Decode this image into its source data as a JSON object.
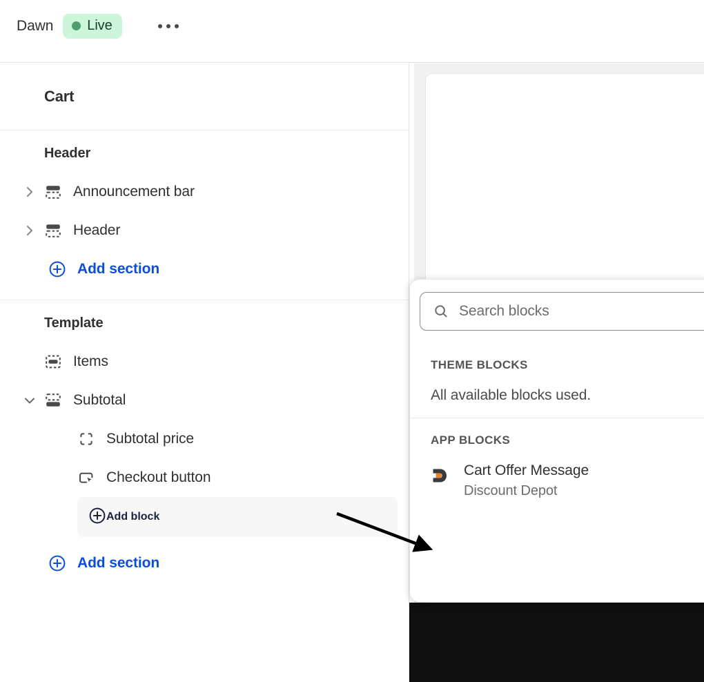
{
  "topbar": {
    "theme_name": "Dawn",
    "status_badge": {
      "label": "Live",
      "dot_color": "#4e9e70",
      "background": "#cdf5d9",
      "text_color": "#113c25"
    },
    "more_menu_label": "•••"
  },
  "sidebar": {
    "header_title": "Cart",
    "groups": [
      {
        "title": "Header",
        "rows": [
          {
            "label": "Announcement bar",
            "icon": "section-icon",
            "caret": "chevron-right",
            "indent": 1
          },
          {
            "label": "Header",
            "icon": "section-icon",
            "caret": "chevron-right",
            "indent": 1
          }
        ],
        "add_label": "Add section"
      },
      {
        "title": "Template",
        "rows": [
          {
            "label": "Items",
            "icon": "items-section-icon",
            "caret": "none",
            "indent": 1
          },
          {
            "label": "Subtotal",
            "icon": "subtotal-section-icon",
            "caret": "chevron-down",
            "indent": 1
          },
          {
            "label": "Subtotal price",
            "icon": "block-icon",
            "caret": "none",
            "indent": 2
          },
          {
            "label": "Checkout button",
            "icon": "button-block-icon",
            "caret": "none",
            "indent": 2
          }
        ],
        "add_block_label": "Add block",
        "add_label": "Add section"
      }
    ]
  },
  "block_picker": {
    "search": {
      "placeholder": "Search blocks",
      "value": "",
      "icon": "search-icon"
    },
    "theme_blocks": {
      "heading": "THEME BLOCKS",
      "empty_message": "All available blocks used."
    },
    "app_blocks": {
      "heading": "APP BLOCKS",
      "items": [
        {
          "title": "Cart Offer Message",
          "subtitle": "Discount Depot",
          "icon": "discount-depot-icon"
        }
      ]
    }
  },
  "colors": {
    "accent_link": "#0b4fd6",
    "selected_row_bg": "#f7f7f7",
    "app_icon_dark": "#3a3a3a",
    "app_icon_orange": "#e8822d"
  }
}
